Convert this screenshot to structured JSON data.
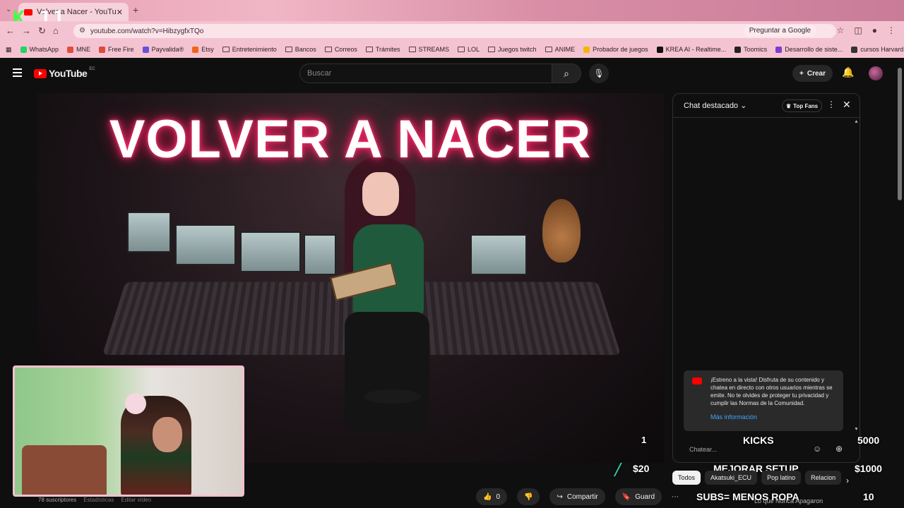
{
  "browser": {
    "tab_title": "Volver a Nacer - YouTube",
    "url": "youtube.com/watch?v=HibzygfxTQo",
    "ask_google": "Preguntar a Google",
    "k_badge_letter": "K",
    "k_badge_number": "11",
    "bookmarks": [
      {
        "label": "WhatsApp",
        "kind": "icon",
        "color": "#25d366"
      },
      {
        "label": "MNE",
        "kind": "icon",
        "color": "#e54b3c"
      },
      {
        "label": "Free Fire",
        "kind": "icon",
        "color": "#e0473f"
      },
      {
        "label": "Payvalida®",
        "kind": "icon",
        "color": "#6b4fd8"
      },
      {
        "label": "Etsy",
        "kind": "icon",
        "color": "#f1641e"
      },
      {
        "label": "Entretenimiento",
        "kind": "folder"
      },
      {
        "label": "Bancos",
        "kind": "folder"
      },
      {
        "label": "Correos",
        "kind": "folder"
      },
      {
        "label": "Trámites",
        "kind": "folder"
      },
      {
        "label": "STREAMS",
        "kind": "folder"
      },
      {
        "label": "LOL",
        "kind": "folder"
      },
      {
        "label": "Juegos twitch",
        "kind": "folder"
      },
      {
        "label": "ANIME",
        "kind": "folder"
      },
      {
        "label": "Probador de juegos",
        "kind": "icon",
        "color": "#f2b705"
      },
      {
        "label": "KREA AI - Realtime...",
        "kind": "icon",
        "color": "#111111"
      },
      {
        "label": "Toomics",
        "kind": "icon",
        "color": "#222222"
      },
      {
        "label": "Desarrollo de siste...",
        "kind": "icon",
        "color": "#7a3fd1"
      },
      {
        "label": "cursos Harvard",
        "kind": "icon",
        "color": "#333333"
      }
    ]
  },
  "youtube": {
    "logo_text": "YouTube",
    "country": "EC",
    "search_placeholder": "Buscar",
    "create_label": "Crear"
  },
  "video": {
    "title_overlay": "VOLVER A NACER"
  },
  "chat": {
    "title": "Chat destacado",
    "top_fans": "Top Fans",
    "notice": "¡Estreno a la vista! Disfruta de su contenido y chatea en directo con otros usuarios mientras se emite. No te olvides de proteger tu privacidad y cumplir las Normas de la Comunidad.",
    "more_info": "Más información",
    "input_placeholder": "Chatear..."
  },
  "stream_overlay": {
    "counter1": "1",
    "kicks_label": "KICKS",
    "kicks_goal": "5000",
    "amount20": "$20",
    "mejorar_label": "MEJORAR SETUP",
    "mejorar_goal": "$1000",
    "subs_label": "SUBS= MENOS ROPA",
    "subs_goal": "10"
  },
  "actions": {
    "likes": "0",
    "share": "Compartir",
    "save": "Guard"
  },
  "channel": {
    "subscribers": "78 suscriptores",
    "stats": "Estadísticas",
    "edit": "Editar vídeo"
  },
  "chips": [
    "Todos",
    "Akatsuki_ECU",
    "Pop latino",
    "Relacion"
  ],
  "related_title": "Lo que Nunca Apagaron"
}
